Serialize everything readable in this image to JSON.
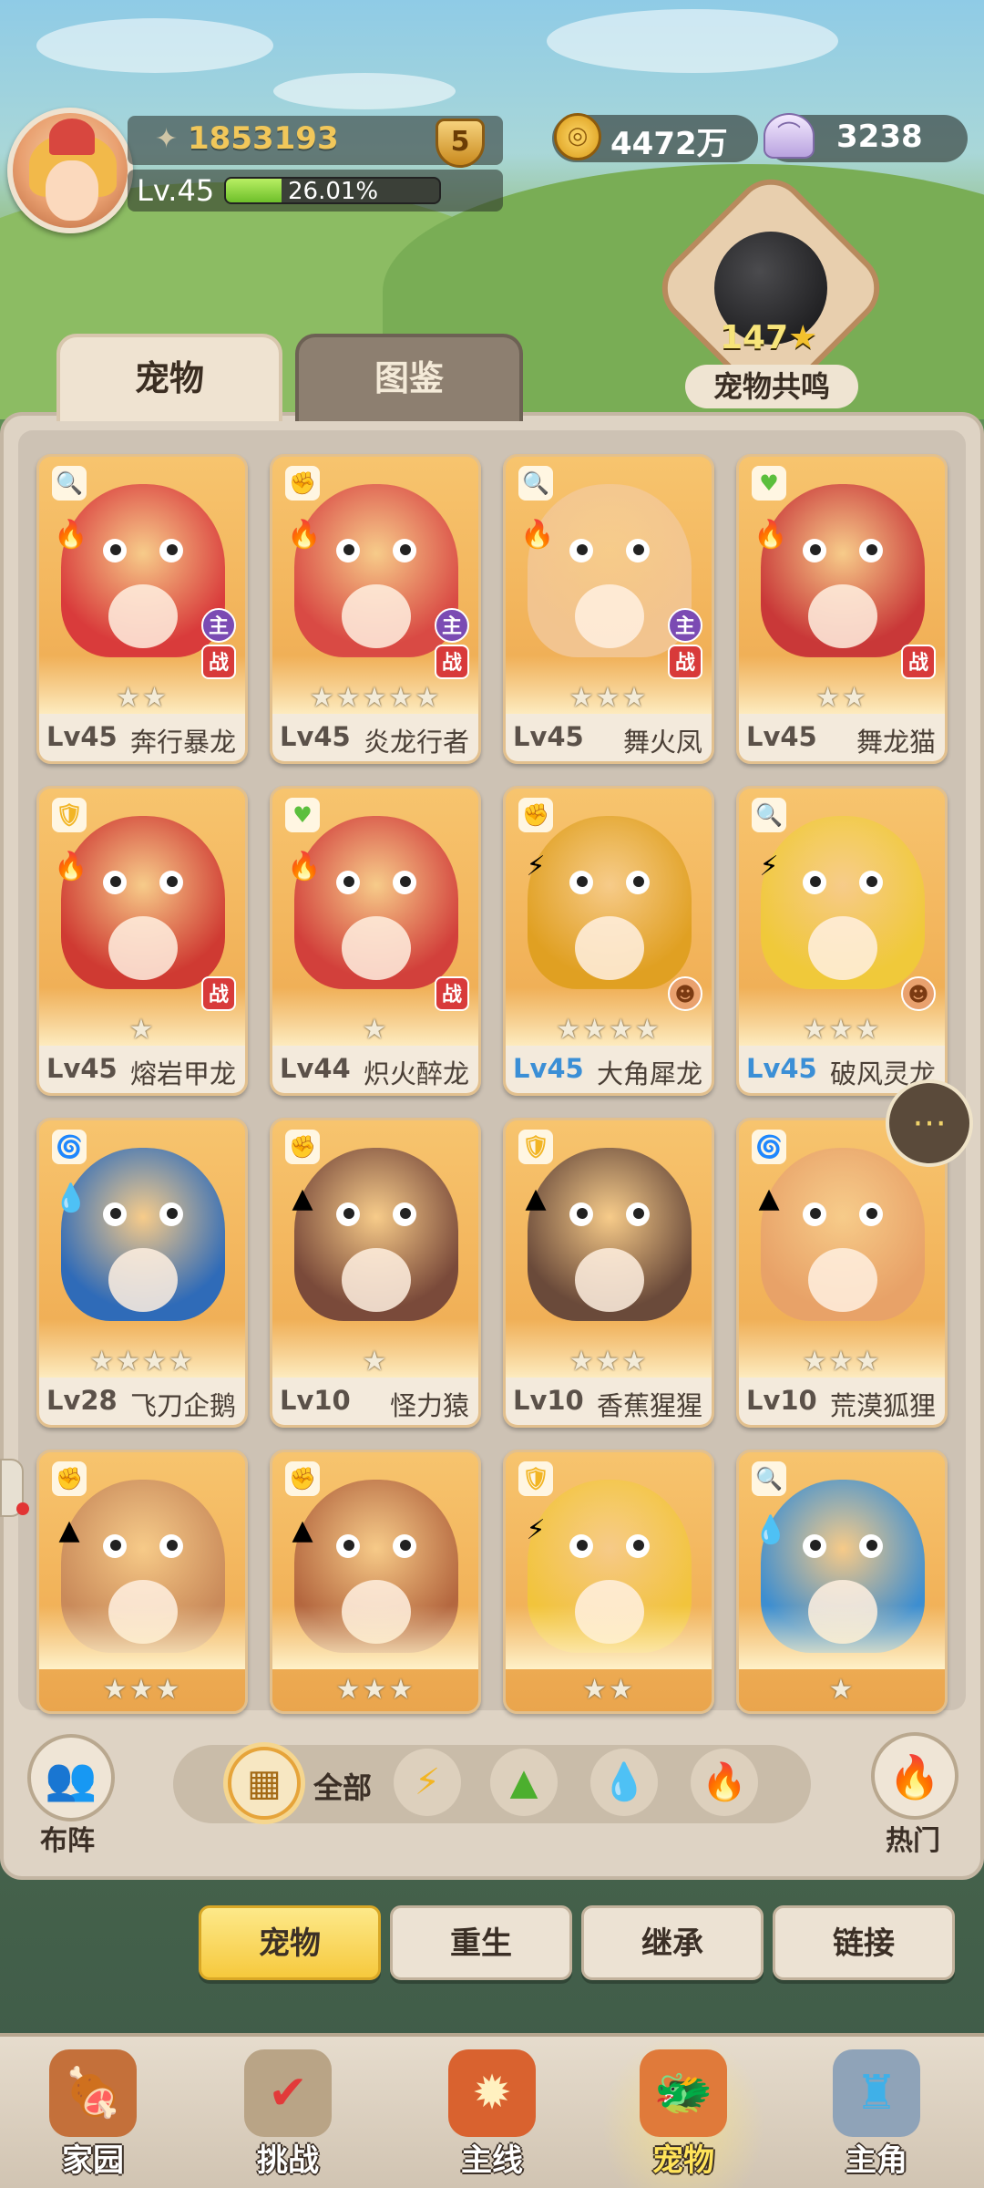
{
  "player": {
    "power": "1853193",
    "vip": "5",
    "level": "Lv.45",
    "exp_percent": "26.01%",
    "exp_fraction": 0.2601
  },
  "resources": {
    "gold": "4472万",
    "shells": "3238"
  },
  "resonance": {
    "count": "147",
    "label": "宠物共鸣"
  },
  "tabs": [
    {
      "label": "宠物"
    },
    {
      "label": "图鉴"
    }
  ],
  "pets": [
    {
      "lv": "Lv45",
      "name": "奔行暴龙",
      "stars": 2,
      "cls": "🔍",
      "cls_color": "#3fa7e8",
      "elem": "🔥",
      "elem2": "",
      "badges": [
        "主",
        "战"
      ],
      "color": "#d93b3b",
      "lvblue": false
    },
    {
      "lv": "Lv45",
      "name": "炎龙行者",
      "stars": 5,
      "cls": "✊",
      "cls_color": "#e15b3a",
      "elem": "🔥",
      "elem2": "",
      "badges": [
        "主",
        "战"
      ],
      "color": "#d94a44",
      "lvblue": false
    },
    {
      "lv": "Lv45",
      "name": "舞火凤",
      "stars": 3,
      "cls": "🔍",
      "cls_color": "#3fa7e8",
      "elem": "🔥",
      "elem2": "",
      "badges": [
        "主",
        "战"
      ],
      "color": "#f2c48f",
      "lvblue": false
    },
    {
      "lv": "Lv45",
      "name": "舞龙猫",
      "stars": 2,
      "cls": "♥",
      "cls_color": "#5bbf3c",
      "elem": "🔥",
      "elem2": "",
      "badges": [
        "战"
      ],
      "color": "#c93838",
      "lvblue": false
    },
    {
      "lv": "Lv45",
      "name": "熔岩甲龙",
      "stars": 1,
      "cls": "🛡",
      "cls_color": "#f2b524",
      "elem": "🔥",
      "elem2": "",
      "badges": [
        "战"
      ],
      "color": "#cf3a32",
      "lvblue": false
    },
    {
      "lv": "Lv44",
      "name": "炽火醉龙",
      "stars": 1,
      "cls": "♥",
      "cls_color": "#5bbf3c",
      "elem": "🔥",
      "elem2": "",
      "badges": [
        "战"
      ],
      "color": "#d2403b",
      "lvblue": false
    },
    {
      "lv": "Lv45",
      "name": "大角犀龙",
      "stars": 4,
      "cls": "✊",
      "cls_color": "#e15b3a",
      "elem": "⚡",
      "elem2": "",
      "badges": [
        "emblem"
      ],
      "color": "#e0a022",
      "lvblue": true
    },
    {
      "lv": "Lv45",
      "name": "破风灵龙",
      "stars": 3,
      "cls": "🔍",
      "cls_color": "#3fa7e8",
      "elem": "⚡",
      "elem2": "",
      "badges": [
        "emblem"
      ],
      "color": "#f0c93a",
      "lvblue": true
    },
    {
      "lv": "Lv28",
      "name": "飞刀企鹅",
      "stars": 4,
      "cls": "🌀",
      "cls_color": "#b678d9",
      "elem": "💧",
      "elem2": "",
      "badges": [],
      "color": "#2f6bb8",
      "lvblue": false
    },
    {
      "lv": "Lv10",
      "name": "怪力猿",
      "stars": 1,
      "cls": "✊",
      "cls_color": "#e15b3a",
      "elem": "▲",
      "elem2": "",
      "badges": [],
      "color": "#7a4a3a",
      "lvblue": false
    },
    {
      "lv": "Lv10",
      "name": "香蕉猩猩",
      "stars": 3,
      "cls": "🛡",
      "cls_color": "#f2b524",
      "elem": "▲",
      "elem2": "",
      "badges": [],
      "color": "#6a4a3a",
      "lvblue": false
    },
    {
      "lv": "Lv10",
      "name": "荒漠狐狸",
      "stars": 3,
      "cls": "🌀",
      "cls_color": "#b678d9",
      "elem": "▲",
      "elem2": "",
      "badges": [],
      "color": "#e8a268",
      "lvblue": false
    },
    {
      "lv": "",
      "name": "",
      "stars": 3,
      "cls": "✊",
      "cls_color": "#e15b3a",
      "elem": "▲",
      "elem2": "",
      "badges": [],
      "color": "#c98a5a",
      "lvblue": false
    },
    {
      "lv": "",
      "name": "",
      "stars": 3,
      "cls": "✊",
      "cls_color": "#e15b3a",
      "elem": "▲",
      "elem2": "",
      "badges": [],
      "color": "#b4673f",
      "lvblue": false
    },
    {
      "lv": "",
      "name": "",
      "stars": 2,
      "cls": "🛡",
      "cls_color": "#f2b524",
      "elem": "⚡",
      "elem2": "",
      "badges": [],
      "color": "#f2c43c",
      "lvblue": false
    },
    {
      "lv": "",
      "name": "",
      "stars": 1,
      "cls": "🔍",
      "cls_color": "#3fa7e8",
      "elem": "💧",
      "elem2": "",
      "badges": [],
      "color": "#3d8ed0",
      "lvblue": false
    }
  ],
  "filters": {
    "formation": "布阵",
    "all": "全部",
    "hot": "热门",
    "icons": [
      "⚡",
      "▲",
      "💧",
      "🔥"
    ]
  },
  "actions": [
    {
      "label": "宠物"
    },
    {
      "label": "重生"
    },
    {
      "label": "继承"
    },
    {
      "label": "链接"
    }
  ],
  "nav": [
    {
      "label": "家园",
      "icon": "🍖"
    },
    {
      "label": "挑战",
      "icon": "✔"
    },
    {
      "label": "主线",
      "icon": "✹"
    },
    {
      "label": "宠物",
      "icon": "🐲"
    },
    {
      "label": "主角",
      "icon": "♜"
    }
  ],
  "colors": {
    "accent": "#f6c93d",
    "panel": "#ded3c4",
    "card": "#f2b35a"
  }
}
